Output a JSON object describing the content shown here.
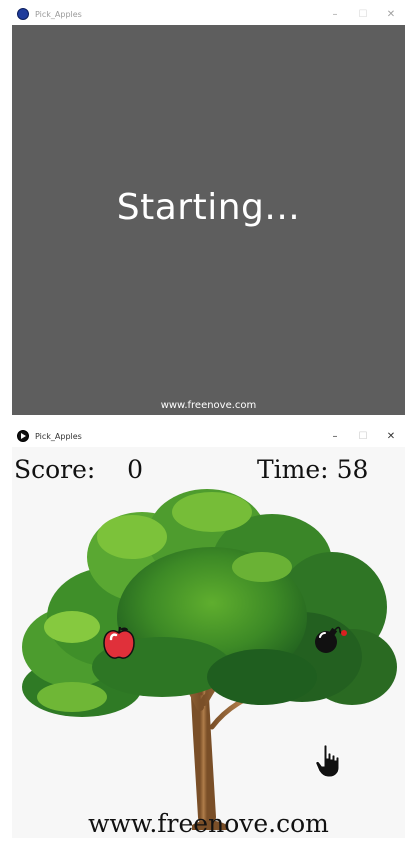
{
  "window1": {
    "title": "Pick_Apples",
    "controls": {
      "minimize": "–",
      "maximize": "☐",
      "close": "✕"
    },
    "canvas": {
      "message": "Starting...",
      "footer": "www.freenove.com",
      "background": "#5e5e5e"
    }
  },
  "window2": {
    "title": "Pick_Apples",
    "controls": {
      "minimize": "–",
      "maximize": "☐",
      "close": "✕"
    },
    "hud": {
      "score_label": "Score:",
      "score_value": "0",
      "time_label": "Time:",
      "time_value": "58"
    },
    "footer": "www.freenove.com",
    "sprites": [
      "apple-icon",
      "bomb-icon",
      "hand-pointer-icon",
      "tree-image"
    ]
  },
  "colors": {
    "canvas_gray": "#5e5e5e",
    "leaf_dark": "#1f5e1f",
    "leaf_light": "#7cc23a",
    "trunk": "#9c6b3c",
    "apple": "#e0303a",
    "bomb": "#111111"
  }
}
